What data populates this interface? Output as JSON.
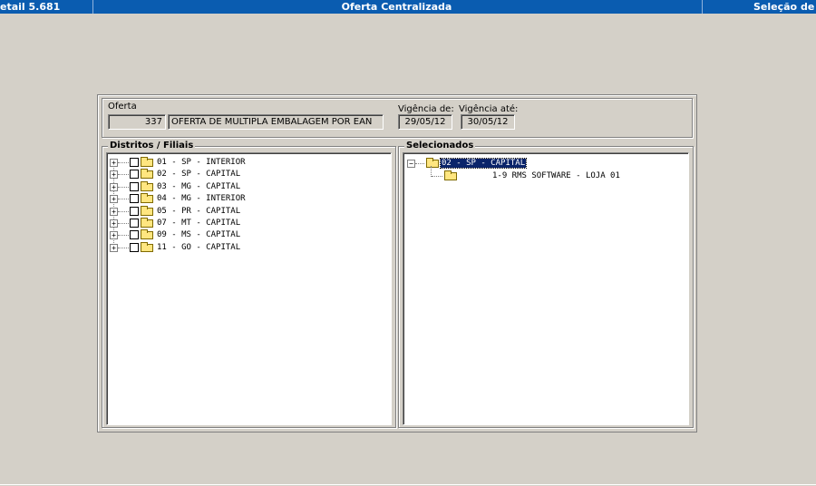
{
  "titlebar": {
    "left": "etail 5.681",
    "center": "Oferta Centralizada",
    "right": "Seleção de F"
  },
  "oferta": {
    "label": "Oferta",
    "code": "337",
    "description": "OFERTA DE MULTIPLA EMBALAGEM POR EAN",
    "vigencia_de_label": "Vigência de:",
    "vigencia_de": "29/05/12",
    "vigencia_ate_label": "Vigência até:",
    "vigencia_ate": "30/05/12"
  },
  "distritos": {
    "title": "Distritos / Filiais",
    "items": [
      {
        "label": "01 - SP - INTERIOR"
      },
      {
        "label": "02 - SP - CAPITAL"
      },
      {
        "label": "03 - MG - CAPITAL"
      },
      {
        "label": "04 - MG - INTERIOR"
      },
      {
        "label": "05 - PR - CAPITAL"
      },
      {
        "label": "07 - MT - CAPITAL"
      },
      {
        "label": "09 - MS - CAPITAL"
      },
      {
        "label": "11 - GO - CAPITAL"
      }
    ]
  },
  "selecionados": {
    "title": "Selecionados",
    "root": "02 - SP - CAPITAL",
    "child": "1-9 RMS SOFTWARE - LOJA 01"
  },
  "icons": {
    "expand": "plus-box-icon",
    "collapse": "minus-box-icon",
    "folder": "folder-icon",
    "checkbox": "checkbox-icon"
  }
}
